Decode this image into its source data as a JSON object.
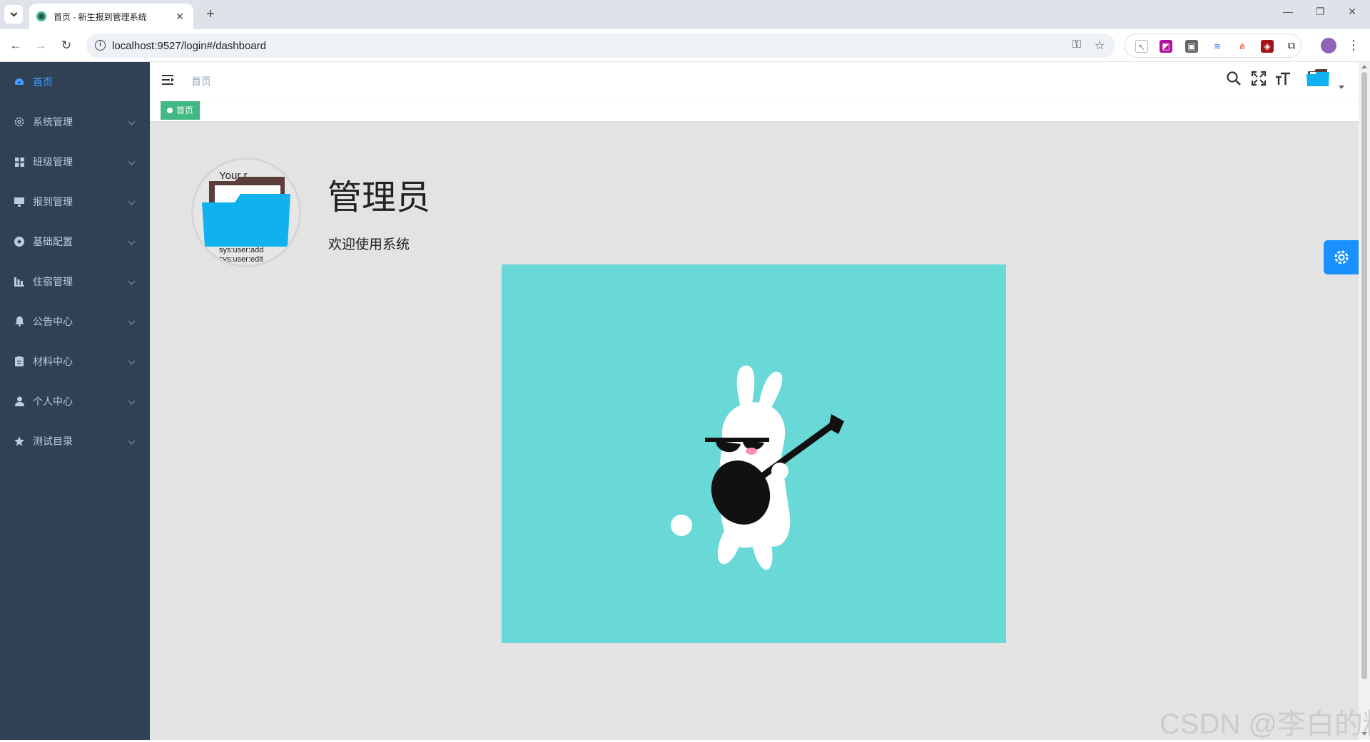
{
  "browser": {
    "tab_title": "首页 - 新生报到管理系统",
    "tab_close": "✕",
    "new_tab": "+",
    "url": "localhost:9527/login#/dashboard",
    "window_controls": [
      "—",
      "❐",
      "✕"
    ]
  },
  "sidebar": {
    "items": [
      {
        "label": "首页",
        "icon": "dashboard-icon",
        "active": true
      },
      {
        "label": "系统管理",
        "icon": "gear-icon"
      },
      {
        "label": "班级管理",
        "icon": "grid-icon"
      },
      {
        "label": "报到管理",
        "icon": "monitor-icon"
      },
      {
        "label": "基础配置",
        "icon": "compass-icon"
      },
      {
        "label": "住宿管理",
        "icon": "chart-icon"
      },
      {
        "label": "公告中心",
        "icon": "bell-icon"
      },
      {
        "label": "材料中心",
        "icon": "clipboard-icon"
      },
      {
        "label": "个人中心",
        "icon": "user-icon"
      },
      {
        "label": "测试目录",
        "icon": "star-icon"
      }
    ]
  },
  "header": {
    "breadcrumb": "首页"
  },
  "tags": {
    "active_tag": "首页"
  },
  "dashboard": {
    "avatar_text_top": "Your r",
    "avatar_text_line1": "sys:user:add",
    "avatar_text_line2": "sys:user:edit",
    "user_name": "管理员",
    "welcome": "欢迎使用系统"
  },
  "watermark": "CSDN @李白的粉",
  "colors": {
    "sidebar_bg": "#304156",
    "sidebar_active": "#409eff",
    "tag_green": "#42b983",
    "hero_bg": "#69d9d7",
    "settings_blue": "#1890ff"
  }
}
